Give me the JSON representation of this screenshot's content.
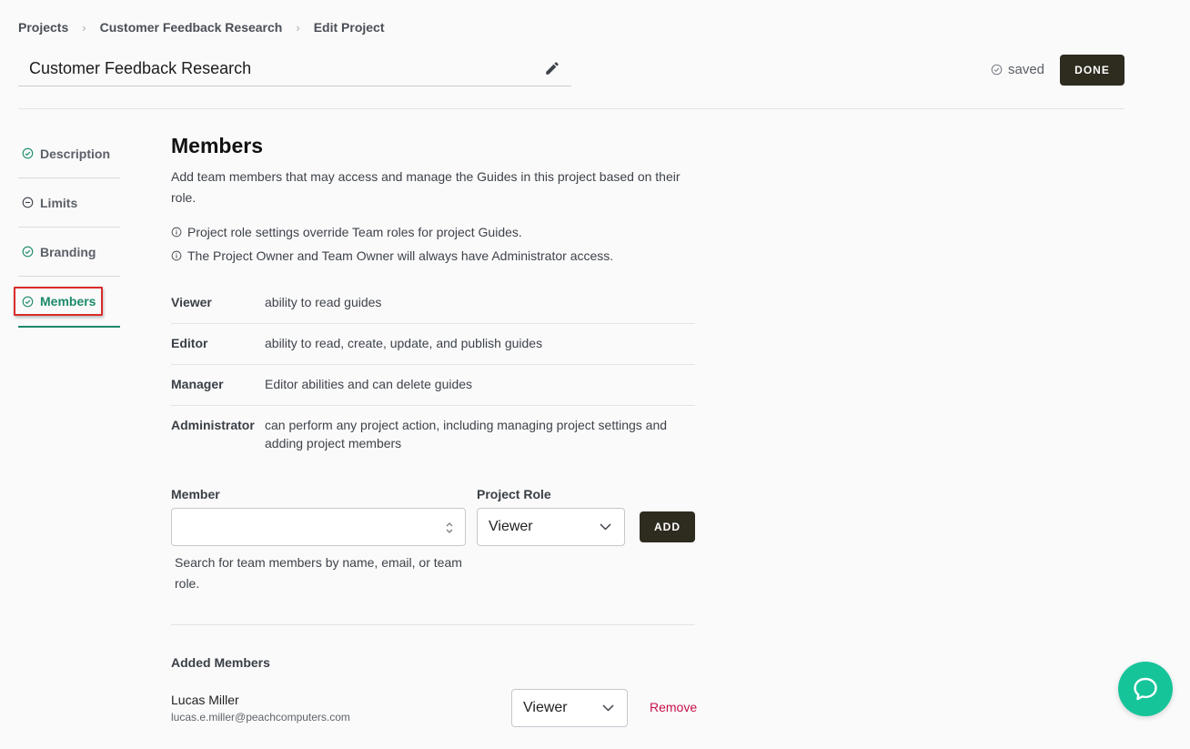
{
  "breadcrumb": {
    "items": [
      "Projects",
      "Customer Feedback Research",
      "Edit Project"
    ]
  },
  "header": {
    "project_title": "Customer Feedback Research",
    "saved_status": "saved",
    "done_label": "DONE"
  },
  "sidebar": {
    "items": [
      {
        "label": "Description",
        "status": "complete"
      },
      {
        "label": "Limits",
        "status": "partial"
      },
      {
        "label": "Branding",
        "status": "complete"
      },
      {
        "label": "Members",
        "status": "complete",
        "active": true
      }
    ]
  },
  "members": {
    "heading": "Members",
    "description": "Add team members that may access and manage the Guides in this project based on their role.",
    "notes": [
      "Project role settings override Team roles for project Guides.",
      "The Project Owner and Team Owner will always have Administrator access."
    ],
    "roles": [
      {
        "name": "Viewer",
        "description": "ability to read guides"
      },
      {
        "name": "Editor",
        "description": "ability to read, create, update, and publish guides"
      },
      {
        "name": "Manager",
        "description": "Editor abilities and can delete guides"
      },
      {
        "name": "Administrator",
        "description": "can perform any project action, including managing project settings and adding project members"
      }
    ],
    "form": {
      "member_label": "Member",
      "member_value": "",
      "role_label": "Project Role",
      "role_value": "Viewer",
      "add_label": "ADD",
      "help_text": "Search for team members by name, email, or team role."
    },
    "added": {
      "heading": "Added Members",
      "list": [
        {
          "name": "Lucas Miller",
          "email": "lucas.e.miller@peachcomputers.com",
          "role": "Viewer",
          "remove_label": "Remove"
        }
      ]
    }
  },
  "colors": {
    "accent": "#1c8a6b",
    "dark_button": "#2e2b1f",
    "remove": "#c8114b",
    "chat": "#16c49a",
    "highlight": "#d92b2b"
  }
}
